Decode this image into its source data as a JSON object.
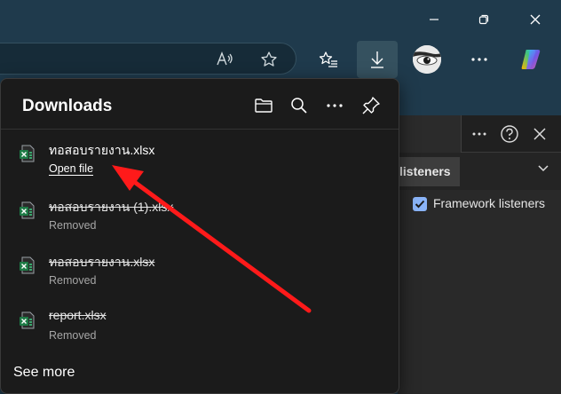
{
  "flyout": {
    "title": "Downloads",
    "see_more": "See more",
    "items": [
      {
        "name": "ทอสอบรายงาน.xlsx",
        "status": "Open file",
        "removed": false
      },
      {
        "name": "ทอสอบรายงาน (1).xlsx",
        "status": "Removed",
        "removed": true
      },
      {
        "name": "ทอสอบรายงาน.xlsx",
        "status": "Removed",
        "removed": true
      },
      {
        "name": "report.xlsx",
        "status": "Removed",
        "removed": true
      }
    ]
  },
  "devtools": {
    "tab_label": "listeners",
    "framework_label": "Framework listeners",
    "framework_checked": true
  },
  "colors": {
    "frame": "#1f3a4c",
    "flyout_bg": "#1b1b1b",
    "excel_green": "#1d7a45",
    "annotation_arrow": "#ff1a1a",
    "checkbox": "#8ab4f8"
  },
  "icons": {
    "minimize": "minimize-icon",
    "maximize": "restore-icon",
    "close": "close-icon",
    "read_aloud": "read-aloud-icon",
    "favorite": "star-icon",
    "favorites": "favorites-list-icon",
    "downloads": "download-icon",
    "more": "more-icon",
    "copilot": "copilot-icon",
    "folder": "folder-icon",
    "search": "search-icon",
    "pin": "pin-icon",
    "help": "help-icon",
    "chevron": "chevron-down-icon"
  }
}
